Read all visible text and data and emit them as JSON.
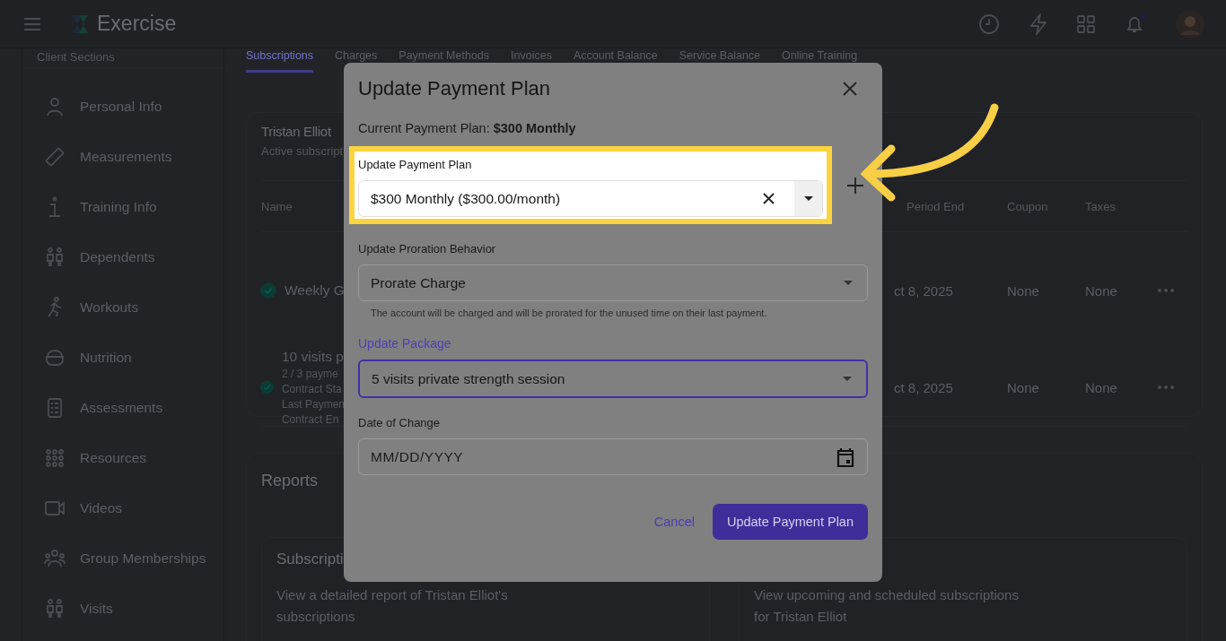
{
  "header": {
    "app_name": "Exercise"
  },
  "sidebar": {
    "heading": "Client Sections",
    "items": [
      {
        "label": "Personal Info"
      },
      {
        "label": "Measurements"
      },
      {
        "label": "Training Info"
      },
      {
        "label": "Dependents"
      },
      {
        "label": "Workouts"
      },
      {
        "label": "Nutrition"
      },
      {
        "label": "Assessments"
      },
      {
        "label": "Resources"
      },
      {
        "label": "Videos"
      },
      {
        "label": "Group Memberships"
      },
      {
        "label": "Visits"
      }
    ]
  },
  "tabs": [
    {
      "label": "Subscriptions",
      "selected": true
    },
    {
      "label": "Charges",
      "selected": false
    },
    {
      "label": "Payment Methods",
      "selected": false
    },
    {
      "label": "Invoices",
      "selected": false
    },
    {
      "label": "Account Balance",
      "selected": false
    },
    {
      "label": "Service Balance",
      "selected": false
    },
    {
      "label": "Online Training",
      "selected": false
    }
  ],
  "subscriptions": {
    "title": "Tristan Elliot",
    "subtitle": "Active subscript",
    "columns": [
      "Name",
      "Period End",
      "Coupon",
      "Taxes"
    ],
    "rows": [
      {
        "name_lines": [
          "Weekly G"
        ],
        "period_end": "ct 8, 2025",
        "coupon": "None",
        "taxes": "None"
      },
      {
        "name_lines": [
          "10 visits p",
          "2 / 3 payme",
          "Contract Sta",
          "Last Paymen",
          "Contract En"
        ],
        "period_end": "ct 8, 2025",
        "coupon": "None",
        "taxes": "None"
      }
    ]
  },
  "reports": {
    "title": "Reports",
    "cards": [
      {
        "title": "Subscripti",
        "description": "View a detailed report of Tristan Elliot's subscriptions"
      },
      {
        "description": "View upcoming and scheduled subscriptions for Tristan Elliot"
      }
    ]
  },
  "modal": {
    "title": "Update Payment Plan",
    "current_plan": "Current Payment Plan: **$300 Monthly**",
    "fields": [
      {
        "kind": "select",
        "label": "Update Payment Plan",
        "value": "$300 Monthly ($300.00/month)",
        "clearable": true,
        "highlighted": true,
        "focused": false
      },
      {
        "kind": "select",
        "label": "Update Proration Behavior",
        "value": "Prorate Charge",
        "helper": "The account will be charged and will be prorated for the unused time on their last payment.",
        "clearable": false,
        "highlighted": false,
        "focused": false
      },
      {
        "kind": "select",
        "label": "Update Package",
        "value": "5 visits private strength session",
        "clearable": false,
        "highlighted": false,
        "focused": true
      },
      {
        "kind": "date",
        "label": "Date of Change",
        "placeholder": "MM/DD/YYYY",
        "highlighted": false,
        "focused": false
      }
    ],
    "cancel": "Cancel",
    "submit": "Update Payment Plan"
  }
}
